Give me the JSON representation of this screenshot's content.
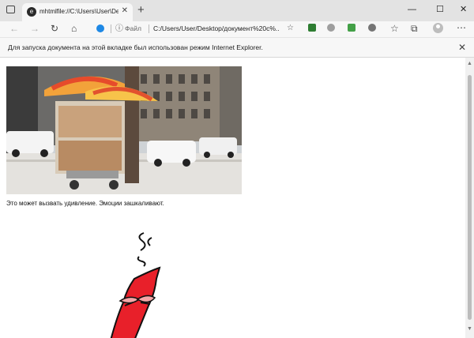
{
  "browser": {
    "tab": {
      "title": "mhtmlfile://C:\\Users\\User\\Desktop\\док",
      "favicon_icon": "ie-mode-icon"
    },
    "new_tab_label": "+",
    "window_controls": [
      "minimize-icon",
      "maximize-icon",
      "close-icon"
    ],
    "address": {
      "label": "Файл",
      "url": "C:/Users/User/Desktop/документ%20c%..."
    },
    "toolbar_icons": [
      "back-icon",
      "forward-icon",
      "refresh-icon",
      "home-icon",
      "favorite-icon",
      "extensions-icons",
      "collections-icon",
      "profile-icon",
      "more-icon"
    ]
  },
  "infobar": {
    "text": "Для запуска документа на этой вкладке был использован режим Internet Explorer."
  },
  "page": {
    "image_description_icon": "hot-dog-cart-photo",
    "caption": "Это может вызвать удивление. Эмоции зашкаливают.",
    "sticker_icon": "angry-red-character-sticker"
  },
  "colors": {
    "accent": "#1e88e5",
    "sticker_red": "#e8202a"
  }
}
